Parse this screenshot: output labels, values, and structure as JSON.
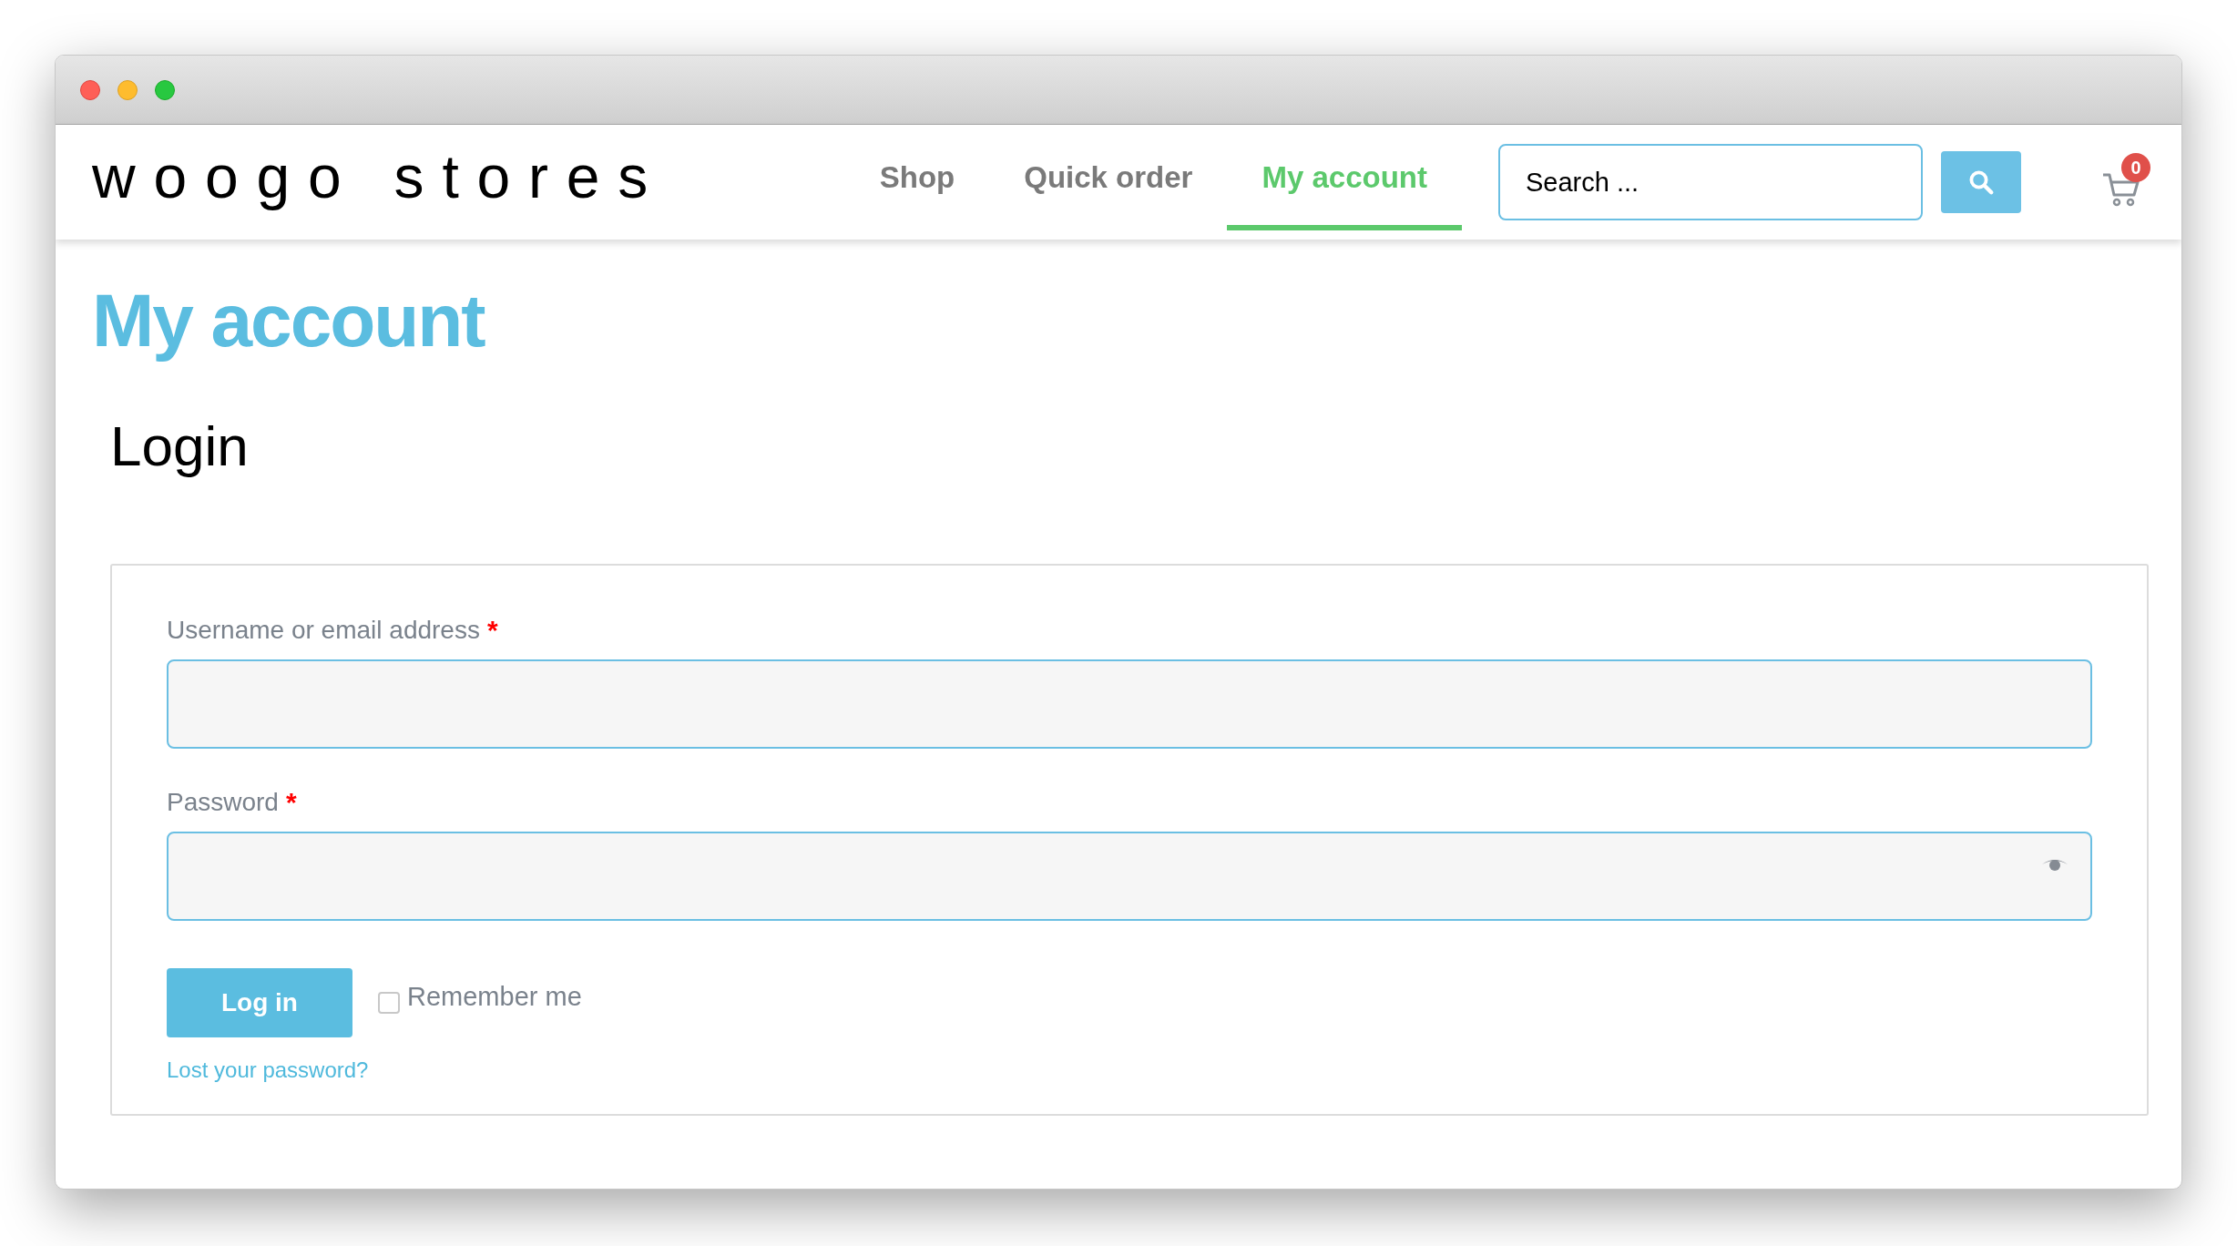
{
  "logo": "woogo stores",
  "nav": [
    {
      "label": "Shop",
      "selected": false
    },
    {
      "label": "Quick order",
      "selected": false
    },
    {
      "label": "My account",
      "selected": true
    }
  ],
  "search": {
    "placeholder": "Search ..."
  },
  "cart": {
    "count": "0"
  },
  "page_title": "My account",
  "section_title": "Login",
  "form": {
    "fields": [
      {
        "label": "Username or email address",
        "required_mark": "*",
        "kind": "text"
      },
      {
        "label": "Password",
        "required_mark": "*",
        "kind": "password"
      }
    ],
    "submit": "Log in",
    "remember": {
      "label": "Remember me",
      "checked": false
    },
    "lost_password": "Lost your password?"
  }
}
